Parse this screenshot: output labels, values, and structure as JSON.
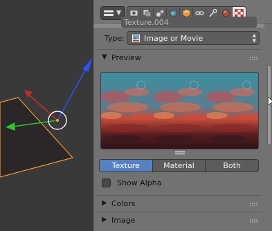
{
  "window": {
    "accent_color": "#5680c2",
    "panel_bg": "#727272",
    "viewport_bg": "#393939"
  },
  "header": {
    "editor_type_icon": "properties-editor-icon",
    "context_tabs": [
      {
        "icon": "render-icon",
        "active": false
      },
      {
        "icon": "render-layers-icon",
        "active": false
      },
      {
        "icon": "scene-icon",
        "active": false
      },
      {
        "icon": "world-icon",
        "active": false
      },
      {
        "icon": "object-icon",
        "active": false
      },
      {
        "icon": "constraints-icon",
        "active": false
      },
      {
        "icon": "modifiers-icon",
        "active": false
      },
      {
        "icon": "material-icon",
        "active": false
      },
      {
        "icon": "texture-icon",
        "active": true
      }
    ]
  },
  "texture": {
    "name": "Texture.004",
    "type_label": "Type:",
    "type_value": "Image or Movie",
    "type_icon": "image-icon"
  },
  "panels": {
    "preview": {
      "title": "Preview",
      "expanded": true
    },
    "colors": {
      "title": "Colors",
      "expanded": false
    },
    "image": {
      "title": "Image",
      "expanded": false
    }
  },
  "preview_tabs": [
    {
      "label": "Texture",
      "active": true
    },
    {
      "label": "Material",
      "active": false
    },
    {
      "label": "Both",
      "active": false
    }
  ],
  "show_alpha": {
    "label": "Show Alpha",
    "checked": false
  }
}
